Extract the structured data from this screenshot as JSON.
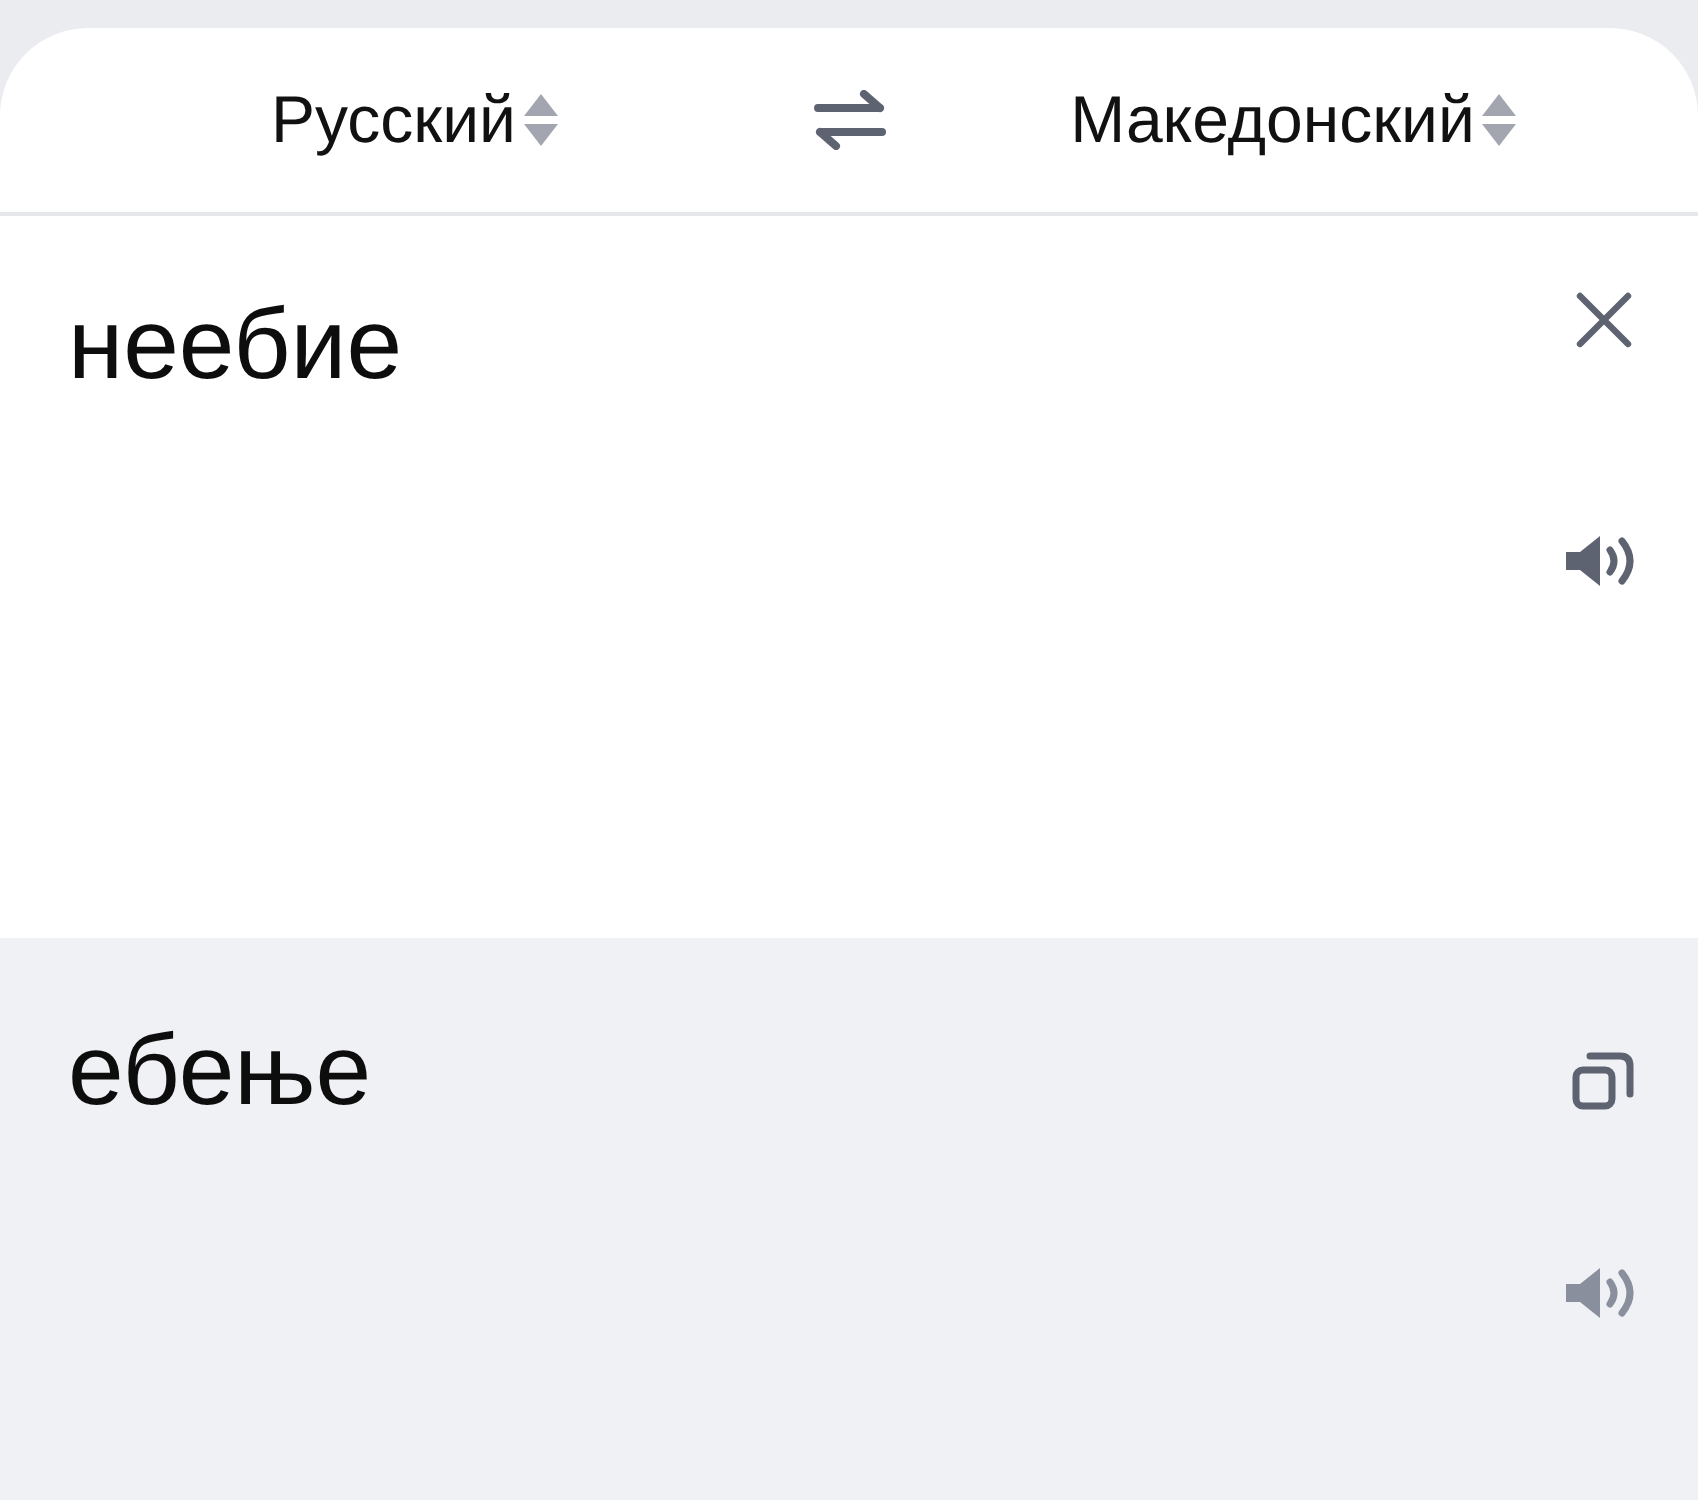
{
  "header": {
    "source_language": {
      "label": "Русский"
    },
    "target_language": {
      "label": "Македонский"
    }
  },
  "input": {
    "text": "неебие"
  },
  "output": {
    "text": "ебење"
  }
}
